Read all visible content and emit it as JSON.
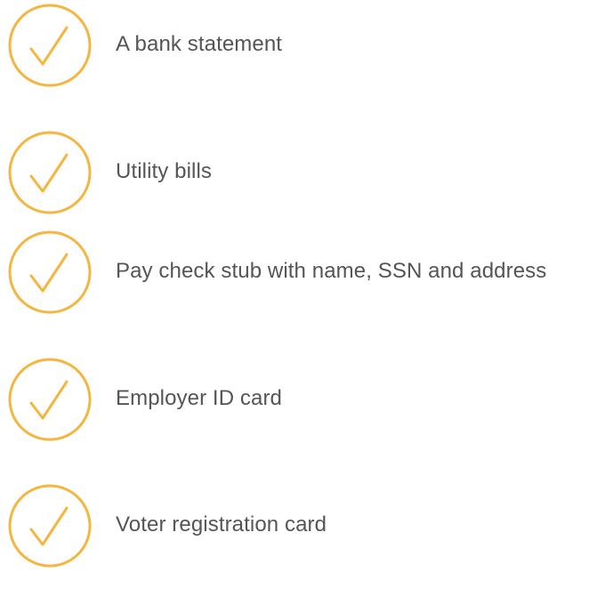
{
  "accent_color": "#F5B640",
  "items": [
    {
      "icon": "check-icon",
      "label": "A bank statement"
    },
    {
      "icon": "check-icon",
      "label": "Utility bills"
    },
    {
      "icon": "check-icon",
      "label": "Pay check stub with name, SSN and address"
    },
    {
      "icon": "check-icon",
      "label": "Employer ID card"
    },
    {
      "icon": "check-icon",
      "label": "Voter registration card"
    }
  ]
}
